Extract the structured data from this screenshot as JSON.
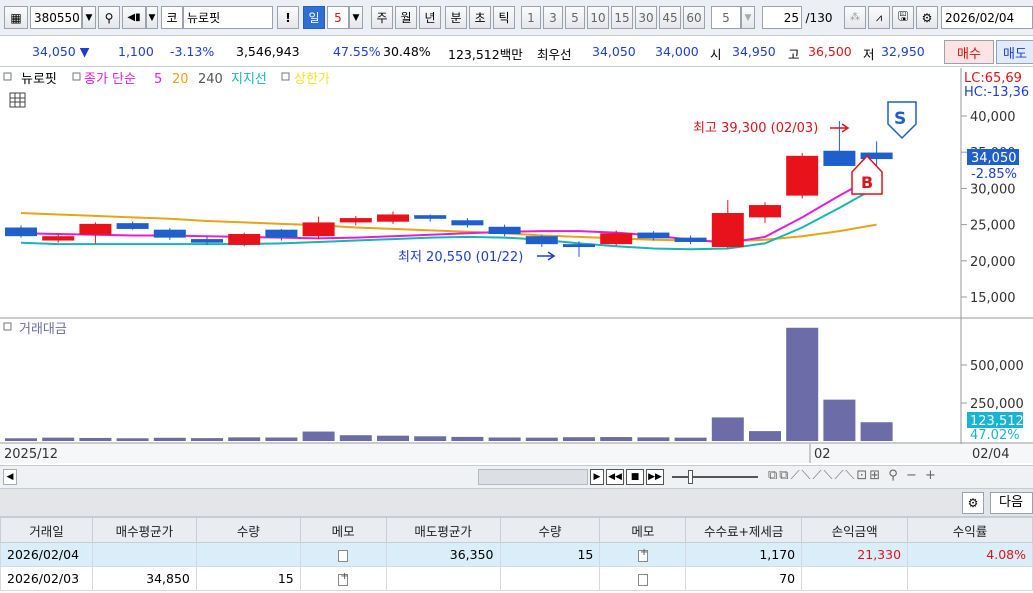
{
  "toolbar": {
    "code": "380550",
    "market": "코",
    "name": "뉴로핏",
    "excl": "!",
    "periods": [
      "일",
      "5",
      "주",
      "월",
      "년",
      "분",
      "초",
      "틱"
    ],
    "intervals": [
      "1",
      "3",
      "5",
      "10",
      "15",
      "30",
      "45",
      "60"
    ],
    "interval_sel": "5",
    "count": "25",
    "total": "/130",
    "date": "2026/02/04"
  },
  "quote": {
    "price": "34,050",
    "arrow": "▼",
    "change": "1,100",
    "rate": "-3.13%",
    "volume": "3,546,943",
    "vol_rate": "47.55%",
    "turnover": "30.48%",
    "amount": "123,512백만",
    "best_label": "최우선",
    "best_ask": "34,050",
    "best_bid": "34,000",
    "open_label": "시",
    "open": "34,950",
    "high_label": "고",
    "high": "36,500",
    "low_label": "저",
    "low": "32,950",
    "buy_btn": "매수",
    "sell_btn": "매도"
  },
  "legend": {
    "name": "뉴로핏",
    "ma_label": "종가 단순",
    "ma5": "5",
    "ma20": "20",
    "ma240": "240",
    "support": "지지선",
    "limit": "상한가"
  },
  "right_top": {
    "lc": "LC:65,69",
    "hc": "HC:-13,36"
  },
  "price_axis": [
    "40,000",
    "35,000",
    "30,000",
    "25,000",
    "20,000",
    "15,000"
  ],
  "price_tag": {
    "value": "34,050",
    "pct": "-2.85%"
  },
  "annotations": {
    "high": "최고 39,300 (02/03)",
    "low": "최저 20,550 (01/22)",
    "buy_mark": "B",
    "sell_mark": "S"
  },
  "volume_panel": {
    "title": "거래대금",
    "axis": [
      "500,000",
      "250,000"
    ],
    "tag": "123,512",
    "tag_pct": "47.02%"
  },
  "dates": {
    "left": "2025/12",
    "mid": "02",
    "right": "02/04"
  },
  "colors": {
    "up": "#e8121a",
    "down": "#1f5fcc",
    "ma5": "#e020d8",
    "ma20": "#18b4b4",
    "ma240": "#e8a317",
    "volume": "#6c6ca8"
  },
  "bottom": {
    "next_btn": "다음"
  },
  "trades": {
    "headers": [
      "거래일",
      "매수평균가",
      "수량",
      "메모",
      "매도평균가",
      "수량",
      "메모",
      "수수료+제세금",
      "손익금액",
      "수익률"
    ],
    "rows": [
      {
        "date": "2026/02/04",
        "buy_avg": "",
        "buy_qty": "",
        "sell_avg": "36,350",
        "sell_qty": "15",
        "fee": "1,170",
        "pnl": "21,330",
        "ret": "4.08%"
      },
      {
        "date": "2026/02/03",
        "buy_avg": "34,850",
        "buy_qty": "15",
        "sell_avg": "",
        "sell_qty": "",
        "fee": "70",
        "pnl": "",
        "ret": ""
      }
    ]
  },
  "chart_data": {
    "type": "candlestick",
    "candles": [
      {
        "o": 24600,
        "h": 24900,
        "l": 23200,
        "c": 23400
      },
      {
        "o": 22800,
        "h": 23800,
        "l": 22500,
        "c": 23400
      },
      {
        "o": 23600,
        "h": 25300,
        "l": 22400,
        "c": 25100
      },
      {
        "o": 25200,
        "h": 25400,
        "l": 24300,
        "c": 24400
      },
      {
        "o": 24300,
        "h": 24500,
        "l": 22900,
        "c": 23200
      },
      {
        "o": 23000,
        "h": 23500,
        "l": 22200,
        "c": 22500
      },
      {
        "o": 22200,
        "h": 23900,
        "l": 22000,
        "c": 23700
      },
      {
        "o": 24300,
        "h": 24400,
        "l": 22800,
        "c": 23200
      },
      {
        "o": 23400,
        "h": 26100,
        "l": 23000,
        "c": 25300
      },
      {
        "o": 25300,
        "h": 26200,
        "l": 24900,
        "c": 25900
      },
      {
        "o": 25400,
        "h": 26800,
        "l": 25100,
        "c": 26400
      },
      {
        "o": 26300,
        "h": 26400,
        "l": 25400,
        "c": 25800
      },
      {
        "o": 25600,
        "h": 25900,
        "l": 24600,
        "c": 24900
      },
      {
        "o": 24700,
        "h": 25000,
        "l": 23400,
        "c": 23700
      },
      {
        "o": 23400,
        "h": 23600,
        "l": 21900,
        "c": 22300
      },
      {
        "o": 22300,
        "h": 22700,
        "l": 20550,
        "c": 21900
      },
      {
        "o": 22300,
        "h": 24200,
        "l": 22100,
        "c": 23800
      },
      {
        "o": 23900,
        "h": 24100,
        "l": 22800,
        "c": 23100
      },
      {
        "o": 23200,
        "h": 23500,
        "l": 22300,
        "c": 22600
      },
      {
        "o": 21900,
        "h": 28400,
        "l": 21700,
        "c": 26600
      },
      {
        "o": 26000,
        "h": 28100,
        "l": 25200,
        "c": 27700
      },
      {
        "o": 29000,
        "h": 34900,
        "l": 28600,
        "c": 34500
      },
      {
        "o": 35200,
        "h": 39300,
        "l": 33100,
        "c": 33100
      },
      {
        "o": 34950,
        "h": 36500,
        "l": 32950,
        "c": 34050
      }
    ],
    "ma5": [
      23800,
      23700,
      23600,
      23500,
      23500,
      23400,
      23300,
      23200,
      23100,
      23200,
      23400,
      23600,
      23800,
      24000,
      24100,
      24100,
      23900,
      23500,
      22900,
      22500,
      23300,
      26000,
      29000,
      31800
    ],
    "ma20": [
      22500,
      22300,
      22300,
      22300,
      22300,
      22300,
      22300,
      22400,
      22600,
      22800,
      23000,
      23200,
      23300,
      23200,
      22900,
      22400,
      22000,
      21700,
      21600,
      21700,
      22400,
      24600,
      27300,
      30200
    ],
    "ma240": [
      26600,
      26400,
      26200,
      26000,
      25800,
      25500,
      25300,
      25100,
      24900,
      24600,
      24400,
      24200,
      24000,
      23800,
      23500,
      23300,
      23100,
      22900,
      22800,
      22700,
      22900,
      23400,
      24100,
      25000
    ],
    "amounts": [
      18000,
      22000,
      20000,
      18000,
      21000,
      19000,
      24000,
      23000,
      62000,
      38000,
      35000,
      31000,
      27000,
      23000,
      22000,
      25000,
      26000,
      24000,
      22000,
      155000,
      65000,
      745000,
      272000,
      123512
    ]
  }
}
